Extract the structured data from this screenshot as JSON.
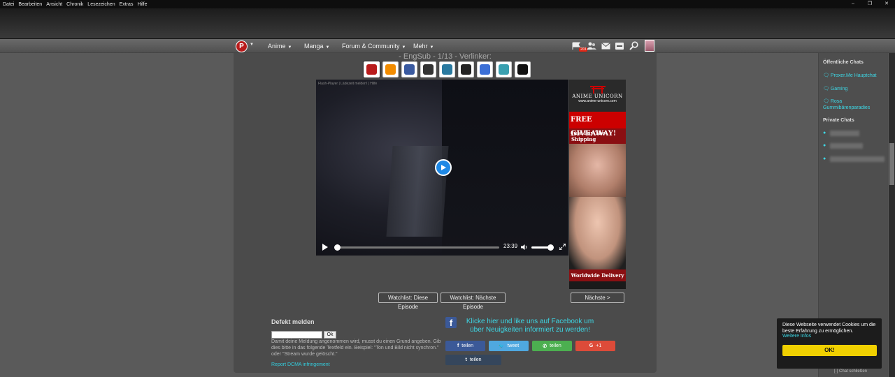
{
  "browser": {
    "menu": [
      "Datei",
      "Bearbeiten",
      "Ansicht",
      "Chronik",
      "Lesezeichen",
      "Extras",
      "Hilfe"
    ],
    "window_controls": [
      "–",
      "❐",
      "✕"
    ]
  },
  "nav": {
    "logo_text": "P",
    "items": [
      {
        "label": "Anime"
      },
      {
        "label": "Manga"
      },
      {
        "label": "Forum & Community"
      },
      {
        "label": "Mehr"
      }
    ],
    "notification_count": "203",
    "icons": [
      "flag-icon",
      "friends-icon",
      "mail-icon",
      "minus-icon",
      "search-icon"
    ]
  },
  "episode": {
    "title": "- EngSub - 1/13 - Verlinker:"
  },
  "hosters": [
    {
      "name": "proxer",
      "color": "#b91c1c"
    },
    {
      "name": "crunchyroll",
      "color": "#f28c00"
    },
    {
      "name": "hoster-3",
      "color": "#3a5aa0"
    },
    {
      "name": "hoster-4",
      "color": "#333333"
    },
    {
      "name": "hoster-5",
      "color": "#2a7aa0"
    },
    {
      "name": "hoster-6",
      "color": "#222222"
    },
    {
      "name": "hoster-7",
      "color": "#3b6fd6"
    },
    {
      "name": "hoster-8",
      "color": "#39a0b0"
    },
    {
      "name": "hoster-9",
      "color": "#111111"
    }
  ],
  "player": {
    "flash_note": "Flash-Player | Lädezeit melden! | Hilfe",
    "duration": "23:39",
    "progress_fraction": 0.0,
    "volume_fraction": 1.0
  },
  "ad": {
    "brand": "ANIME UNICORN",
    "url": "www.anime-unicorn.com",
    "headline": "FREE GIVEAWAY!",
    "subline": "Just Pay The Shipping",
    "footer": "Worldwide Delivery"
  },
  "buttons": {
    "watchlist_this": "Watchlist: Diese Episode",
    "watchlist_next": "Watchlist: Nächste Episode",
    "next": "Nächste >"
  },
  "report": {
    "title": "Defekt melden",
    "ok": "Ok",
    "info": "Damit deine Meldung angenommen wird, musst du einen Grund angeben. Gib dies bitte in das folgende Textfeld ein. Beispiel: \"Ton und Bild nicht synchron.\" oder \"Stream wurde gelöscht.\"",
    "dmca": "Report DCMA infringement"
  },
  "facebook": {
    "text": "Klicke hier und like uns auf Facebook um über Neuigkeiten informiert zu werden!"
  },
  "share": [
    {
      "label": "teilen",
      "icon": "facebook-icon",
      "color": "#3b5998"
    },
    {
      "label": "tweet",
      "icon": "twitter-icon",
      "color": "#4fa8e0"
    },
    {
      "label": "teilen",
      "icon": "whatsapp-icon",
      "color": "#4caf50"
    },
    {
      "label": "+1",
      "icon": "googleplus-icon",
      "color": "#dd4b39"
    },
    {
      "label": "teilen",
      "icon": "tumblr-icon",
      "color": "#35465c"
    }
  ],
  "chat": {
    "public_title": "Öffentliche Chats",
    "public": [
      "Proxer.Me Hauptchat",
      "Gaming",
      "Rosa Gummibärenparadies"
    ],
    "private_title": "Private Chats",
    "close_label": "[-] Chat schließen"
  },
  "cookie": {
    "message": "Diese Webseite verwendet Cookies um die beste Erfahrung zu ermöglichen.",
    "more": "Weitere Infos",
    "ok": "OK!"
  }
}
